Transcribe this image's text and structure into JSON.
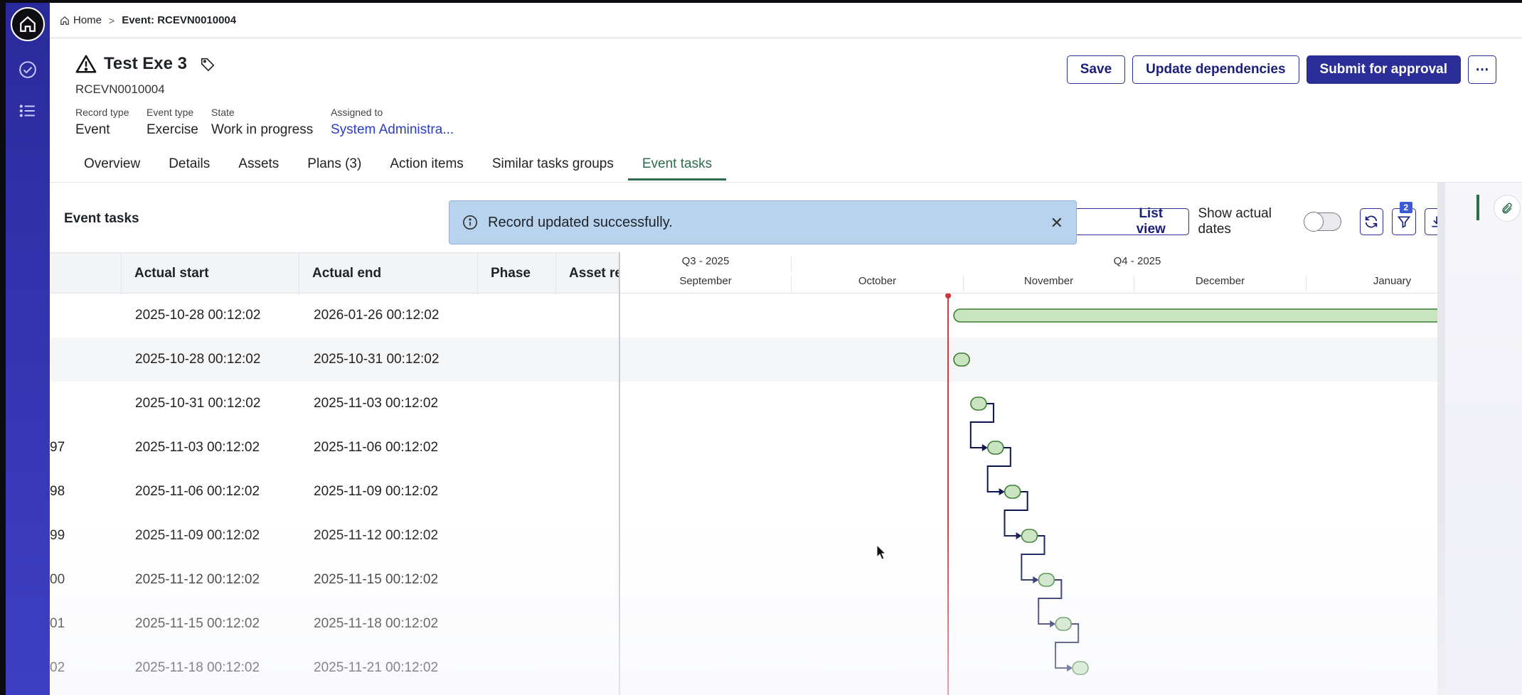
{
  "breadcrumb": {
    "home": "Home",
    "current": "Event: RCEVN0010004"
  },
  "record": {
    "title": "Test Exe 3",
    "id": "RCEVN0010004",
    "fields": [
      {
        "label": "Record type",
        "value": "Event",
        "link": false
      },
      {
        "label": "Event type",
        "value": "Exercise",
        "link": false
      },
      {
        "label": "State",
        "value": "Work in progress",
        "link": false
      },
      {
        "label": "Assigned to",
        "value": "System Administra...",
        "link": true
      }
    ]
  },
  "actions": {
    "save": "Save",
    "update_dependencies": "Update dependencies",
    "submit": "Submit for approval",
    "more": "⋯"
  },
  "tabs": [
    {
      "label": "Overview",
      "active": false
    },
    {
      "label": "Details",
      "active": false
    },
    {
      "label": "Assets",
      "active": false
    },
    {
      "label": "Plans (3)",
      "active": false
    },
    {
      "label": "Action items",
      "active": false
    },
    {
      "label": "Similar tasks groups",
      "active": false
    },
    {
      "label": "Event tasks",
      "active": true
    }
  ],
  "section": {
    "title": "Event tasks",
    "list_view": "List view",
    "show_actual_dates": "Show actual dates",
    "filter_badge": "2"
  },
  "toast": {
    "message": "Record updated successfully."
  },
  "table": {
    "columns": [
      "Actual start",
      "Actual end",
      "Phase",
      "Asset re"
    ],
    "rows": [
      {
        "id": "",
        "start": "2025-10-28 00:12:02",
        "end": "2026-01-26 00:12:02"
      },
      {
        "id": "",
        "start": "2025-10-28 00:12:02",
        "end": "2025-10-31 00:12:02"
      },
      {
        "id": "",
        "start": "2025-10-31 00:12:02",
        "end": "2025-11-03 00:12:02"
      },
      {
        "id": "97",
        "start": "2025-11-03 00:12:02",
        "end": "2025-11-06 00:12:02"
      },
      {
        "id": "98",
        "start": "2025-11-06 00:12:02",
        "end": "2025-11-09 00:12:02"
      },
      {
        "id": "99",
        "start": "2025-11-09 00:12:02",
        "end": "2025-11-12 00:12:02"
      },
      {
        "id": "00",
        "start": "2025-11-12 00:12:02",
        "end": "2025-11-15 00:12:02"
      },
      {
        "id": "01",
        "start": "2025-11-15 00:12:02",
        "end": "2025-11-18 00:12:02"
      },
      {
        "id": "02",
        "start": "2025-11-18 00:12:02",
        "end": "2025-11-21 00:12:02"
      }
    ]
  },
  "gantt": {
    "quarters": [
      "Q3 - 2025",
      "Q4 - 2025"
    ],
    "months": [
      "September",
      "October",
      "November",
      "December",
      "January"
    ],
    "today": "2025-10-28",
    "colors": {
      "bar_fill": "#c9e4c1",
      "bar_stroke": "#3f7a35",
      "today_line": "#d1313d",
      "link": "#0d1452"
    }
  }
}
